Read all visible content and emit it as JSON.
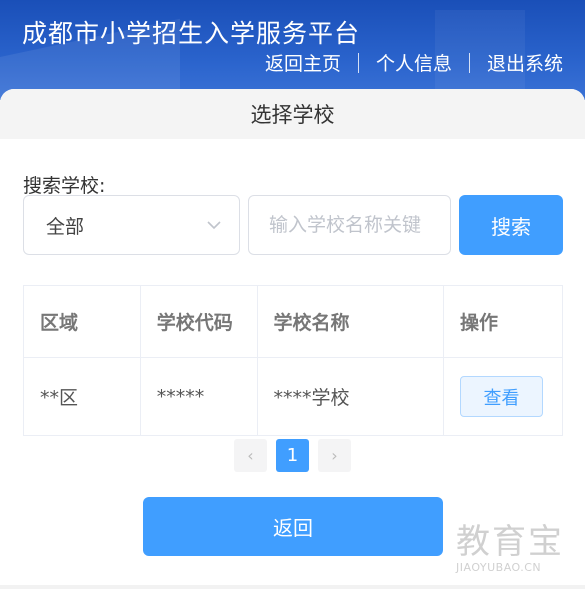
{
  "header": {
    "title": "成都市小学招生入学服务平台",
    "nav": [
      "返回主页",
      "个人信息",
      "退出系统"
    ]
  },
  "card": {
    "title": "选择学校"
  },
  "search": {
    "label": "搜索学校:",
    "region_selected": "全部",
    "input_placeholder": "输入学校名称关键",
    "input_value": "",
    "button_label": "搜索"
  },
  "table": {
    "headers": [
      "区域",
      "学校代码",
      "学校名称",
      "操作"
    ],
    "rows": [
      {
        "region": "**区",
        "code": "*****",
        "name": "****学校",
        "action": "查看"
      }
    ]
  },
  "pagination": {
    "prev": "‹",
    "current": "1",
    "next": "›"
  },
  "back_button": "返回",
  "watermark": {
    "big": "教育宝",
    "small": "JIAOYUBAO.CN"
  },
  "colors": {
    "primary": "#409eff",
    "header_bg": "#1a4fb8"
  }
}
